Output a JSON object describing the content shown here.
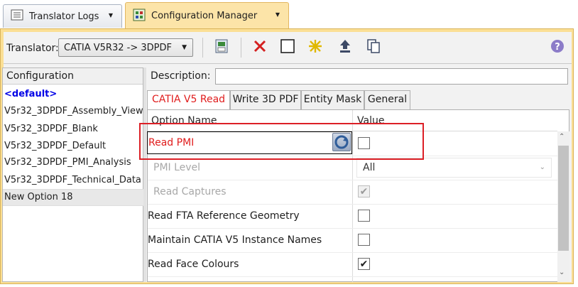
{
  "doc_tabs": [
    {
      "label": "Translator Logs",
      "icon": "log-list-icon"
    },
    {
      "label": "Configuration Manager",
      "icon": "config-manager-icon"
    }
  ],
  "toolbar": {
    "translator_label": "Translator:",
    "translator_value": "CATIA V5R32 -> 3DPDF",
    "buttons": [
      "save-config-icon",
      "delete-icon",
      "new-blank-icon",
      "new-option-icon",
      "export-icon",
      "copy-icon",
      "help-icon"
    ]
  },
  "config_panel": {
    "header": "Configuration",
    "items": [
      "<default>",
      "V5r32_3DPDF_Assembly_View",
      "V5r32_3DPDF_Blank",
      "V5r32_3DPDF_Default",
      "V5r32_3DPDF_PMI_Analysis",
      "V5r32_3DPDF_Technical_Data",
      "New Option 18"
    ],
    "selected_index": 6
  },
  "description": {
    "label": "Description:",
    "value": ""
  },
  "settings_tabs": [
    "CATIA V5 Read",
    "Write 3D PDF",
    "Entity Mask",
    "General"
  ],
  "grid": {
    "col_option": "Option Name",
    "col_value": "Value",
    "rows": [
      {
        "name": "Read PMI",
        "checked": false,
        "disabled": false
      },
      {
        "name": "PMI Level",
        "combo": "All",
        "disabled": true
      },
      {
        "name": "Read Captures",
        "checked": true,
        "disabled": true
      },
      {
        "name": "Read FTA Reference Geometry",
        "checked": false,
        "disabled": false
      },
      {
        "name": "Maintain CATIA V5 Instance Names",
        "checked": false,
        "disabled": false
      },
      {
        "name": "Read Face Colours",
        "checked": true,
        "disabled": false
      }
    ]
  },
  "colors": {
    "accent_tab": "#fce4a8",
    "annotation": "#dc1f26",
    "active_text": "#e01c1c"
  }
}
